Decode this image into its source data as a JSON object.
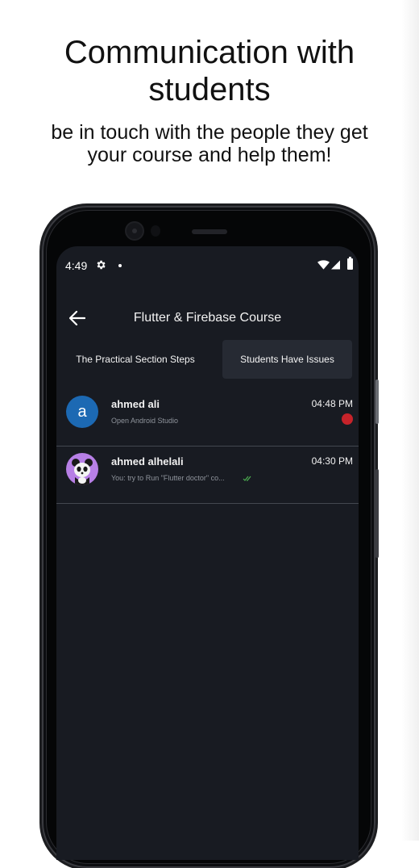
{
  "promo": {
    "headline_line1": "Communication with",
    "headline_line2": "students",
    "subtitle_line1": "be in touch with the people they get",
    "subtitle_line2": "your course and help them!"
  },
  "status_bar": {
    "time": "4:49",
    "icons": [
      "gear-icon",
      "dot-icon",
      "wifi-icon",
      "signal-icon",
      "battery-icon"
    ]
  },
  "app_bar": {
    "back_icon": "arrow-left-icon",
    "title": "Flutter & Firebase Course"
  },
  "tabs": [
    {
      "label": "The Practical Section Steps",
      "selected": false
    },
    {
      "label": "Students Have Issues",
      "selected": true
    }
  ],
  "conversations": [
    {
      "name": "ahmed ali",
      "avatar_letter": "a",
      "avatar_color": "#1c69b3",
      "last_message": "Open Android Studio",
      "time": "04:48 PM",
      "unread": true,
      "unread_color": "#c6232a"
    },
    {
      "name": "ahmed alhelali",
      "avatar_icon": "panda-avatar-icon",
      "avatar_color": "#b77fe6",
      "last_message": "You: try to Run \"Flutter doctor\" co...",
      "time": "04:30 PM",
      "read_receipt": "double-check-icon",
      "read_color": "#4caf50"
    }
  ],
  "colors": {
    "screen_bg": "#181b22",
    "selected_tab_bg": "#262a33"
  }
}
